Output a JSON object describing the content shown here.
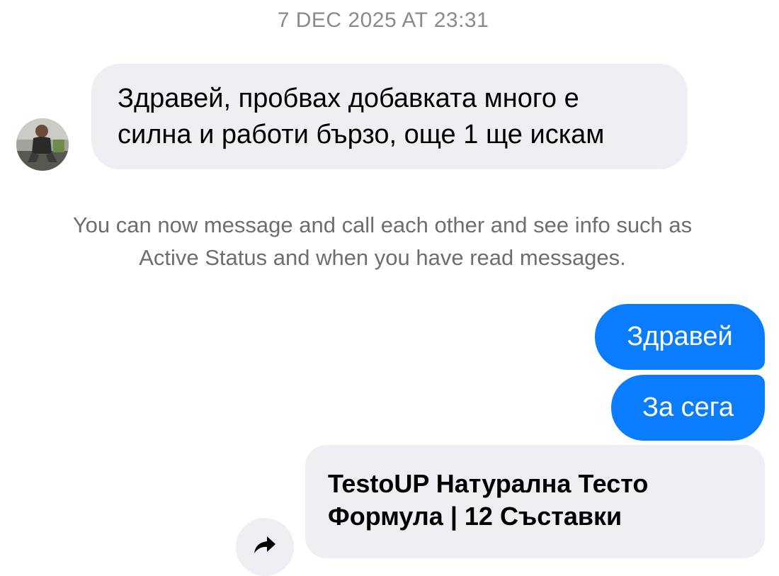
{
  "conversation": {
    "timestamp": "7 DEC 2025 AT 23:31",
    "incoming_message": {
      "line1": "Здравей, пробвах добавката много е",
      "line2": "силна и работи бързо, още 1 ще искам"
    },
    "system_note": {
      "line1": "You can now message and call each other and see info such as",
      "line2": "Active Status and when you have read messages."
    },
    "outgoing_messages": [
      {
        "text": "Здравей"
      },
      {
        "text": "За сега"
      }
    ],
    "link_preview": {
      "title_line1": "TestoUP Натурална Тесто",
      "title_line2": "Формула | 12 Съставки"
    },
    "icons": {
      "share": "share-arrow-icon",
      "avatar": "contact-avatar"
    },
    "colors": {
      "outgoing_bubble": "#0a7cff",
      "incoming_bubble": "#efeff3",
      "meta_text": "#8a8a8e"
    }
  }
}
